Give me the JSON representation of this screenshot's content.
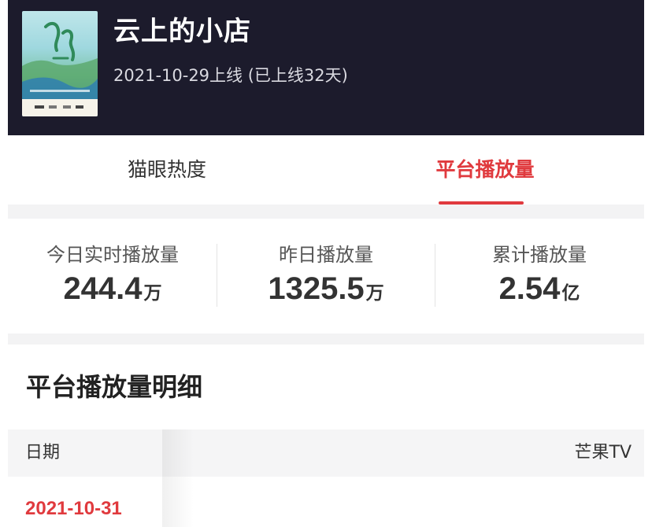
{
  "show": {
    "title": "云上的小店",
    "release_info": "2021-10-29上线 (已上线32天)",
    "poster_icon": "show-poster-image"
  },
  "tabs": [
    {
      "label": "猫眼热度",
      "active": false
    },
    {
      "label": "平台播放量",
      "active": true
    }
  ],
  "stats": [
    {
      "label": "今日实时播放量",
      "value": "244.4",
      "unit": "万"
    },
    {
      "label": "昨日播放量",
      "value": "1325.5",
      "unit": "万"
    },
    {
      "label": "累计播放量",
      "value": "2.54",
      "unit": "亿"
    }
  ],
  "detail": {
    "title": "平台播放量明细",
    "columns": {
      "date": "日期",
      "platform": "芒果TV"
    },
    "rows": [
      {
        "date": "2021-10-31"
      }
    ]
  },
  "colors": {
    "accent": "#e03a3e",
    "header_bg": "#1c1b2c"
  }
}
